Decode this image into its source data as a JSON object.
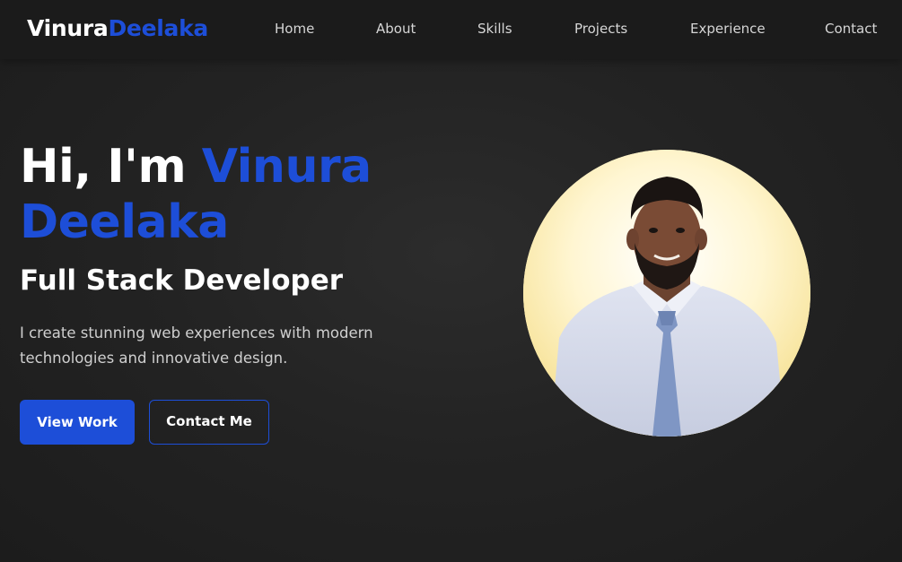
{
  "brand": {
    "first": "Vinura",
    "last": "Deelaka"
  },
  "nav": {
    "items": [
      {
        "label": "Home"
      },
      {
        "label": "About"
      },
      {
        "label": "Skills"
      },
      {
        "label": "Projects"
      },
      {
        "label": "Experience"
      },
      {
        "label": "Contact"
      }
    ]
  },
  "hero": {
    "greeting_prefix": "Hi, I'm ",
    "first_name": "Vinura",
    "last_name": "Deelaka",
    "role": "Full Stack Developer",
    "description": "I create stunning web experiences with modern technologies and innovative design.",
    "primary_button": "View Work",
    "secondary_button": "Contact Me"
  },
  "colors": {
    "accent": "#1d4ed8",
    "background": "#222222",
    "navbar": "#1b1b1b"
  }
}
